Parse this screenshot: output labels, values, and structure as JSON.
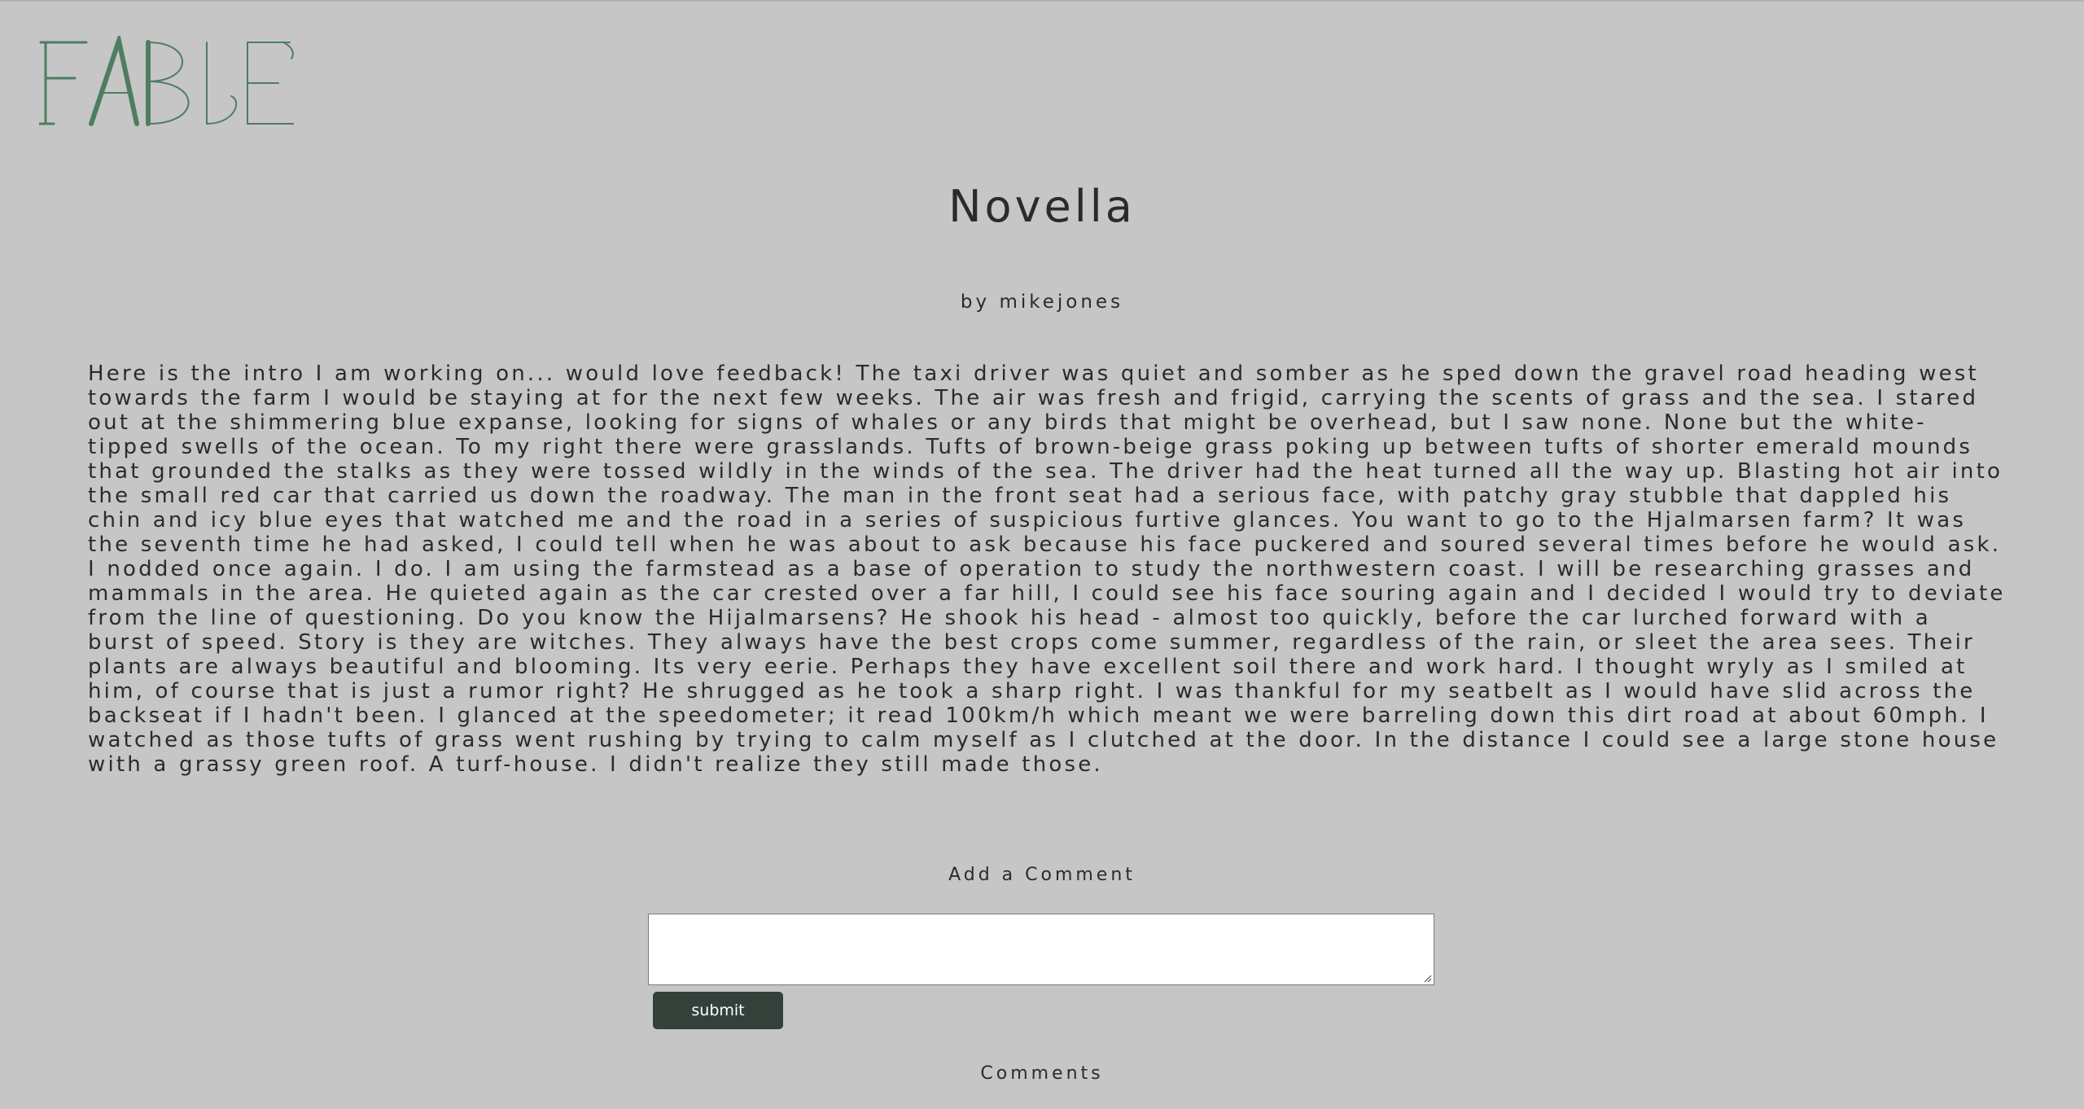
{
  "brand": {
    "logo_text": "FABLE",
    "logo_color": "#4e7d62"
  },
  "story": {
    "title": "Novella",
    "author_line": "by mikejones",
    "body": "Here is the intro I am working on... would love feedback! The taxi driver was quiet and somber as he sped down the gravel road heading west towards the farm I would be staying at for the next few weeks. The air was fresh and frigid, carrying the scents of grass and the sea. I stared out at the shimmering blue expanse, looking for signs of whales or any birds that might be overhead, but I saw none. None but the white-tipped swells of the ocean. To my right there were grasslands. Tufts of brown-beige grass poking up between tufts of shorter emerald mounds that grounded the stalks as they were tossed wildly in the winds of the sea. The driver had the heat turned all the way up. Blasting hot air into the small red car that carried us down the roadway. The man in the front seat had a serious face, with patchy gray stubble that dappled his chin and icy blue eyes that watched me and the road in a series of suspicious furtive glances. You want to go to the Hjalmarsen farm? It was the seventh time he had asked, I could tell when he was about to ask because his face puckered and soured several times before he would ask. I nodded once again. I do. I am using the farmstead as a base of operation to study the northwestern coast. I will be researching grasses and mammals in the area. He quieted again as the car crested over a far hill, I could see his face souring again and I decided I would try to deviate from the line of questioning. Do you know the Hijalmarsens? He shook his head - almost too quickly, before the car lurched forward with a burst of speed. Story is they are witches. They always have the best crops come summer, regardless of the rain, or sleet the area sees. Their plants are always beautiful and blooming. Its very eerie. Perhaps they have excellent soil there and work hard. I thought wryly as I smiled at him, of course that is just a rumor right? He shrugged as he took a sharp right. I was thankful for my seatbelt as I would have slid across the backseat if I hadn't been. I glanced at the speedometer; it read 100km/h which meant we were barreling down this dirt road at about 60mph. I watched as those tufts of grass went rushing by trying to calm myself as I clutched at the door. In the distance I could see a large stone house with a grassy green roof. A turf-house. I didn't realize they still made those."
  },
  "comment_form": {
    "heading": "Add a Comment",
    "textarea_value": "",
    "submit_label": "submit",
    "submit_color": "#34403a"
  },
  "comments": {
    "heading": "Comments"
  },
  "colors": {
    "background": "#c6c6c6",
    "text": "#2b2b2b"
  }
}
